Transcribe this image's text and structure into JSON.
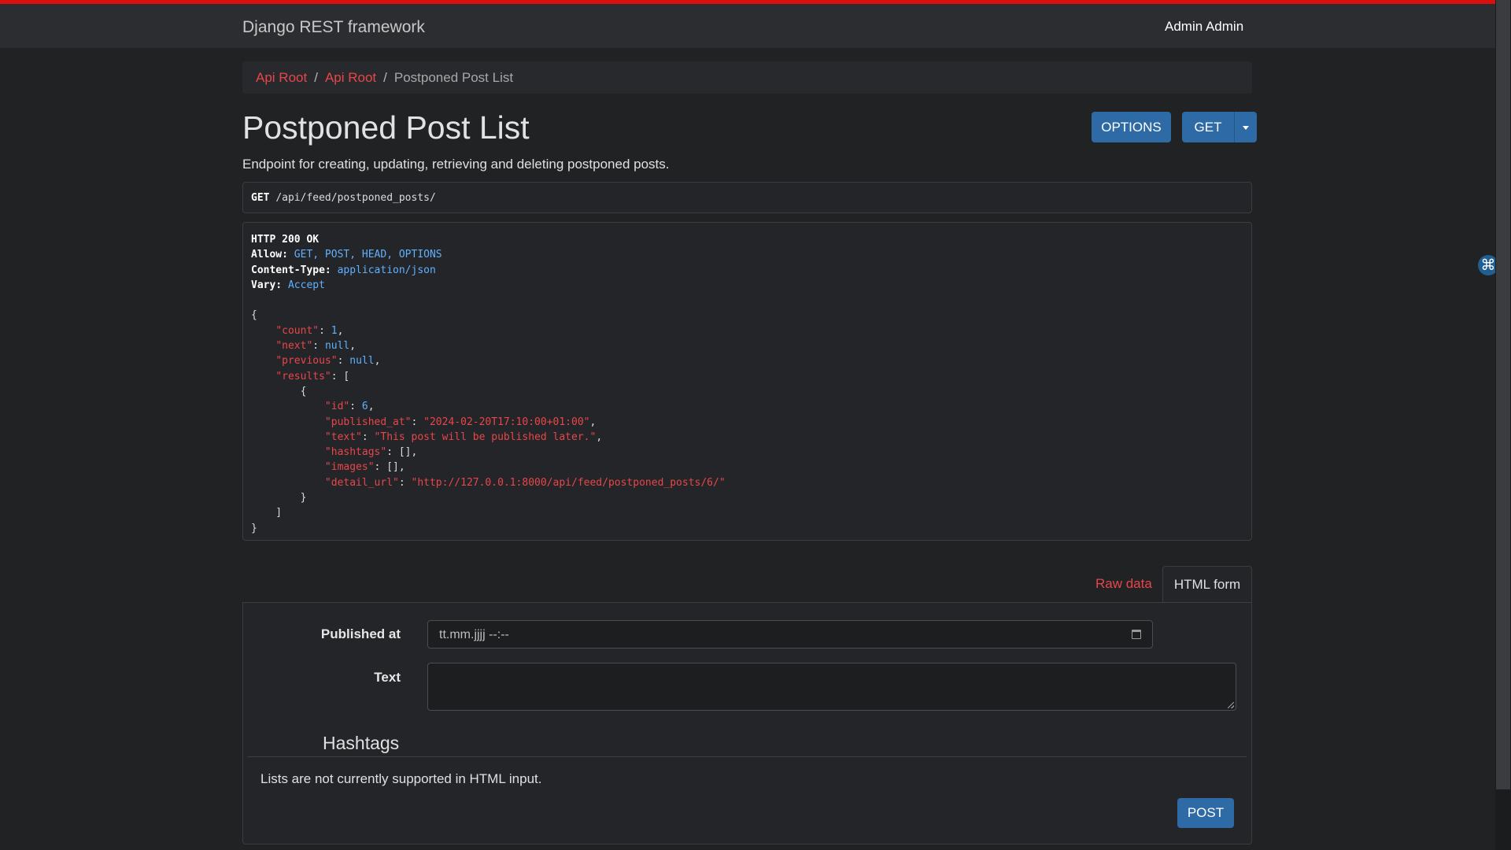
{
  "navbar": {
    "brand": "Django REST framework",
    "user": "Admin Admin"
  },
  "breadcrumb": {
    "items": [
      "Api Root",
      "Api Root"
    ],
    "separator": "/",
    "active": "Postponed Post List"
  },
  "page": {
    "title": "Postponed Post List",
    "description": "Endpoint for creating, updating, retrieving and deleting postponed posts."
  },
  "actions": {
    "options_label": "OPTIONS",
    "get_label": "GET",
    "caret_icon": "caret-down-icon"
  },
  "request": {
    "method": "GET",
    "path": "/api/feed/postponed_posts/"
  },
  "response": {
    "status": "HTTP 200 OK",
    "allow_label": "Allow:",
    "allow": "GET, POST, HEAD, OPTIONS",
    "ctype_label": "Content-Type:",
    "ctype": "application/json",
    "vary_label": "Vary:",
    "vary": "Accept",
    "body": {
      "count_key": "\"count\"",
      "count": "1",
      "next_key": "\"next\"",
      "next": "null",
      "previous_key": "\"previous\"",
      "previous": "null",
      "results_key": "\"results\"",
      "id_key": "\"id\"",
      "id": "6",
      "published_key": "\"published_at\"",
      "published": "\"2024-02-20T17:10:00+01:00\"",
      "text_key": "\"text\"",
      "text": "\"This post will be published later.\"",
      "hashtags_key": "\"hashtags\"",
      "hashtags": "[]",
      "images_key": "\"images\"",
      "images": "[]",
      "detail_key": "\"detail_url\"",
      "detail": "\"http://127.0.0.1:8000/api/feed/postponed_posts/6/\""
    }
  },
  "tabs": {
    "raw": "Raw data",
    "html": "HTML form"
  },
  "form": {
    "published_label": "Published at",
    "published_value": "tt.mm.jjjj --:--",
    "text_label": "Text",
    "hashtags_legend": "Hashtags",
    "hashtags_hint": "Lists are not currently supported in HTML input.",
    "post_label": "POST"
  },
  "colors": {
    "accent": "#e8464a",
    "button": "#2e6aa6",
    "topstripe": "#d90f10",
    "json_value": "#5fb1ff"
  },
  "side_widget": {
    "glyph": "⌘"
  }
}
